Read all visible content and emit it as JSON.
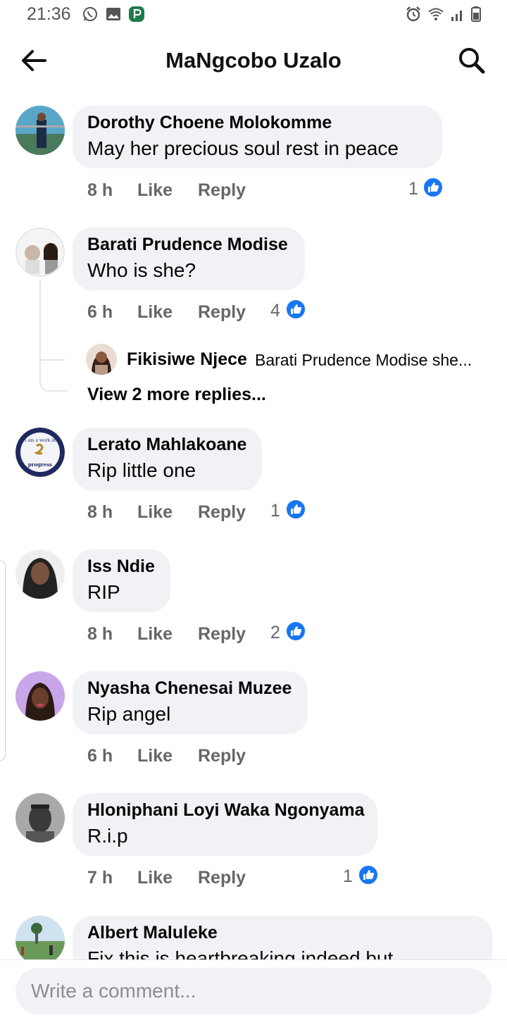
{
  "status_bar": {
    "time": "21:36",
    "left_icons": [
      "whatsapp-icon",
      "gallery-icon",
      "app-notification-icon"
    ],
    "right_icons": [
      "alarm-icon",
      "wifi-icon",
      "signal-icon",
      "battery-icon"
    ]
  },
  "header": {
    "title": "MaNgcobo Uzalo",
    "back_icon": "back-arrow-icon",
    "search_icon": "search-icon"
  },
  "comments": [
    {
      "name": "Dorothy Choene Molokomme",
      "text": "May her precious soul rest in peace",
      "time": "8 h",
      "like_label": "Like",
      "reply_label": "Reply",
      "reactions": "1"
    },
    {
      "name": "Barati Prudence Modise",
      "text": "Who is she?",
      "time": "6 h",
      "like_label": "Like",
      "reply_label": "Reply",
      "reactions": "4",
      "reply_preview": {
        "name": "Fikisiwe Njece",
        "snippet": "Barati Prudence Modise she..."
      },
      "more_replies_label": "View 2 more replies..."
    },
    {
      "name": "Lerato Mahlakoane",
      "text": "Rip little one",
      "time": "8 h",
      "like_label": "Like",
      "reply_label": "Reply",
      "reactions": "1"
    },
    {
      "name": "Iss Ndie",
      "text": "RIP",
      "time": "8 h",
      "like_label": "Like",
      "reply_label": "Reply",
      "reactions": "2"
    },
    {
      "name": "Nyasha Chenesai Muzee",
      "text": "Rip angel",
      "time": "6 h",
      "like_label": "Like",
      "reply_label": "Reply",
      "reactions": ""
    },
    {
      "name": "Hloniphani Loyi Waka Ngonyama",
      "text": "R.i.p",
      "time": "7 h",
      "like_label": "Like",
      "reply_label": "Reply",
      "reactions": "1"
    },
    {
      "name": "Albert Maluleke",
      "text": "Fix this is heartbreaking indeed but",
      "time": "",
      "like_label": "",
      "reply_label": "",
      "reactions": ""
    }
  ],
  "avatar_badge_text": [
    "I am a work in",
    "progress"
  ],
  "composer": {
    "placeholder": "Write a comment..."
  },
  "colors": {
    "like_blue": "#1877f2",
    "bubble": "#f0f2f5",
    "meta_gray": "#65676b"
  }
}
